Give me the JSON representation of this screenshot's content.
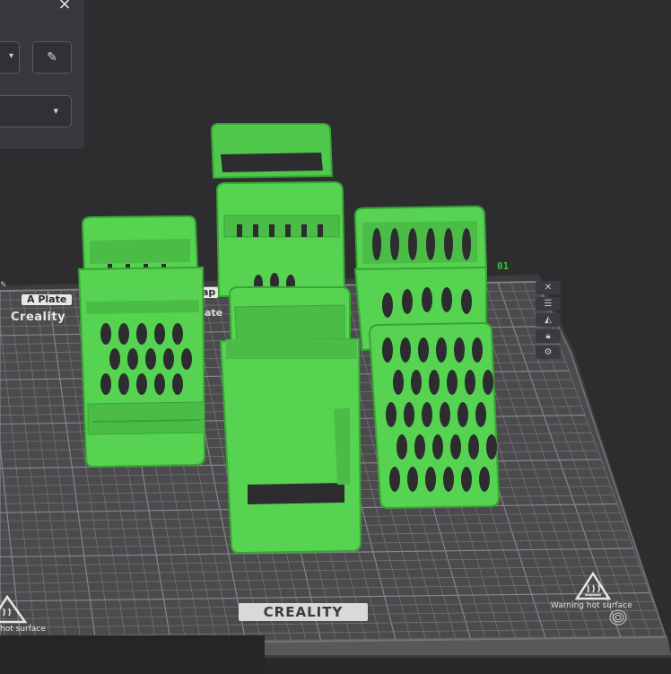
{
  "panel": {
    "close_icon": "×",
    "edit_icon": "✎",
    "caret": "▾"
  },
  "plate": {
    "tab_left": "A Plate",
    "tab_mid": "ap",
    "side_text": "ate",
    "plate_number": "01",
    "brand_top": "Creality",
    "brand_bottom": "CREALITY",
    "warning_right": "Warning hot surface",
    "warning_left": "hot surface"
  },
  "toolbar_icons": [
    "close-icon",
    "arrange-icon",
    "auto-orient-icon",
    "lock-icon",
    "settings-icon"
  ],
  "colors": {
    "model_green": "#56d451",
    "bed": "#4a4a4d",
    "grid": "#7a7a7e",
    "background": "#2d2d30",
    "plate_number": "#35c135"
  }
}
